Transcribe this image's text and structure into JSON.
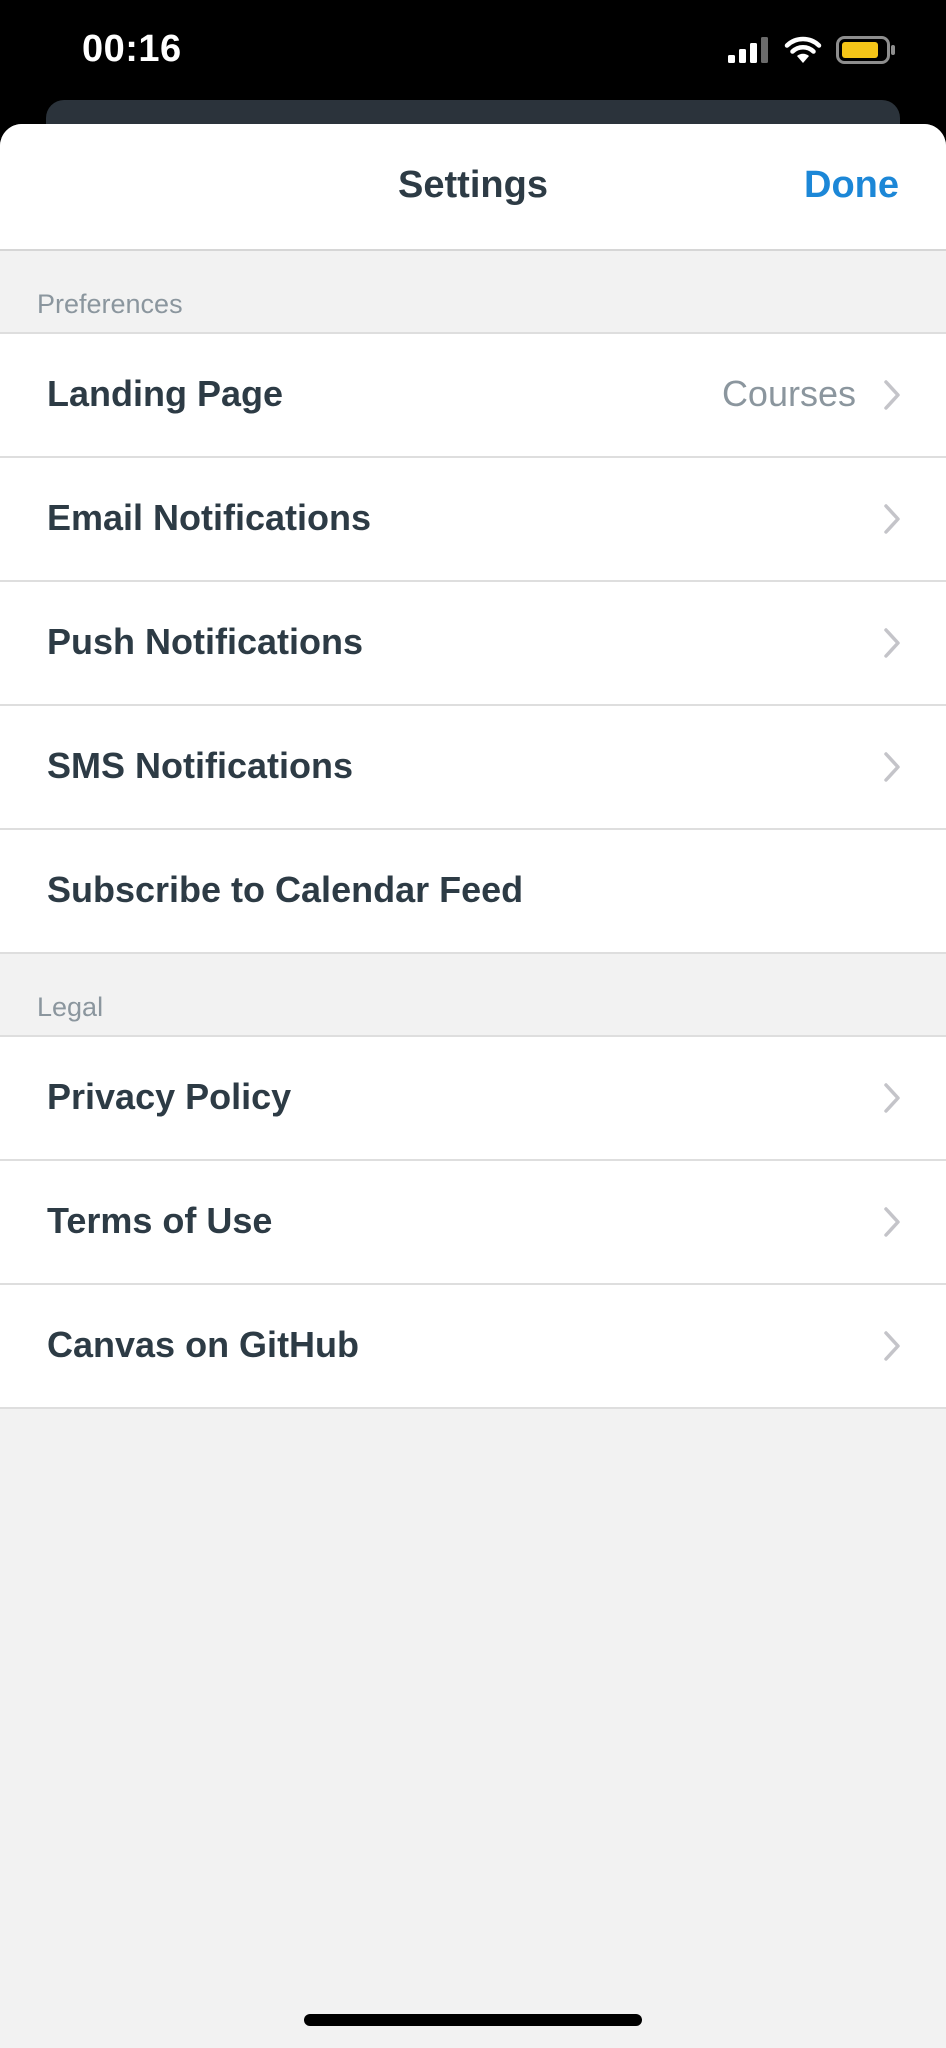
{
  "status_bar": {
    "time": "00:16",
    "icons": [
      "cellular-signal-icon",
      "wifi-icon",
      "battery-icon"
    ],
    "battery_color": "#f5c518"
  },
  "nav": {
    "title": "Settings",
    "done_label": "Done",
    "accent_color": "#1c87d7"
  },
  "sections": {
    "preferences": {
      "header": "Preferences",
      "rows": [
        {
          "label": "Landing Page",
          "value": "Courses"
        },
        {
          "label": "Email Notifications"
        },
        {
          "label": "Push Notifications"
        },
        {
          "label": "SMS Notifications"
        },
        {
          "label": "Subscribe to Calendar Feed"
        }
      ]
    },
    "legal": {
      "header": "Legal",
      "rows": [
        {
          "label": "Privacy Policy"
        },
        {
          "label": "Terms of Use"
        },
        {
          "label": "Canvas on GitHub"
        }
      ]
    }
  }
}
